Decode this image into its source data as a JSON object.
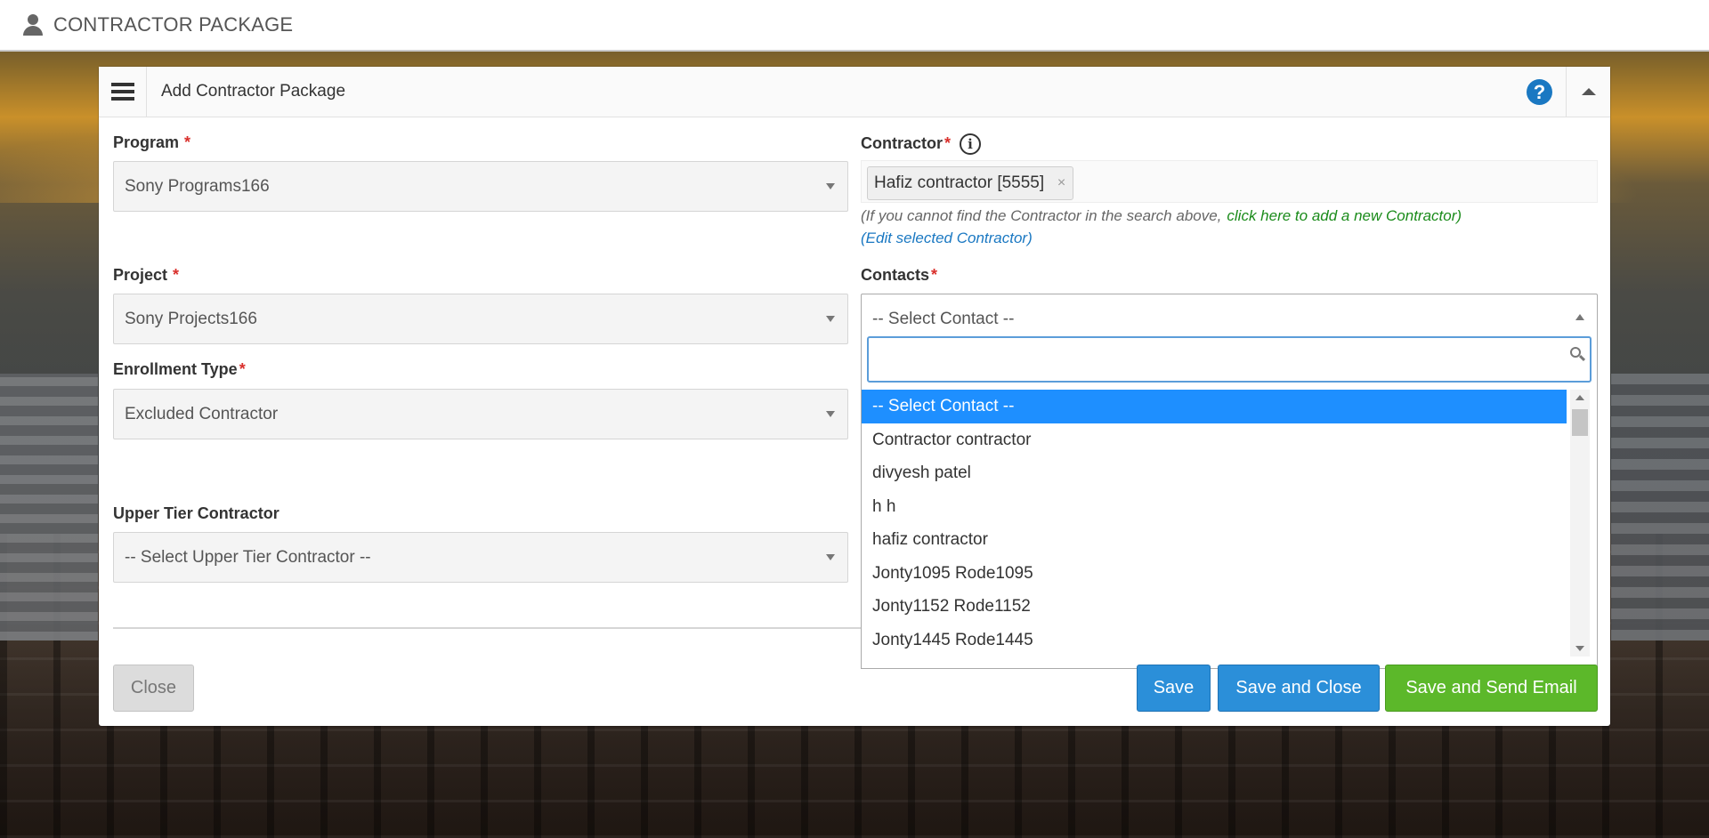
{
  "app": {
    "title": "CONTRACTOR PACKAGE"
  },
  "panel": {
    "title": "Add Contractor Package"
  },
  "colors": {
    "primary": "#2b8fd9",
    "success": "#5cb82a",
    "required": "#d9302c",
    "highlight": "#1e8fff",
    "link_green": "#1a8b1a",
    "link_blue": "#1a78c2"
  },
  "icons": {
    "header": "user-icon",
    "menu": "hamburger-icon",
    "help": "help-icon",
    "collapse": "chevron-up-icon",
    "info": "info-icon",
    "search": "search-icon"
  },
  "form": {
    "program": {
      "label": "Program",
      "required_mark": "*",
      "value": "Sony Programs166"
    },
    "project": {
      "label": "Project",
      "required_mark": "*",
      "value": "Sony Projects166"
    },
    "enrollment_type": {
      "label": "Enrollment Type",
      "required_mark": "*",
      "value": "Excluded Contractor"
    },
    "upper_tier": {
      "label": "Upper Tier Contractor",
      "value": "-- Select Upper Tier Contractor --"
    },
    "contractor": {
      "label": "Contractor",
      "required_mark": "*",
      "info_glyph": "i",
      "selected_tag": "Hafiz contractor [5555]",
      "remove_glyph": "×",
      "hint": "(If you cannot find the Contractor in the search above,",
      "add_link": "click here to add a new Contractor)",
      "edit_link": "(Edit selected Contractor)"
    },
    "contacts": {
      "label": "Contacts",
      "required_mark": "*",
      "value": "-- Select Contact --",
      "search_value": "",
      "options": [
        "-- Select Contact --",
        "Contractor contractor",
        "divyesh patel",
        "h h",
        "hafiz contractor",
        "Jonty1095 Rode1095",
        "Jonty1152 Rode1152",
        "Jonty1445 Rode1445"
      ],
      "highlighted_index": 0
    }
  },
  "buttons": {
    "close": "Close",
    "save": "Save",
    "save_close": "Save and Close",
    "save_email": "Save and Send Email"
  },
  "help_glyph": "?"
}
